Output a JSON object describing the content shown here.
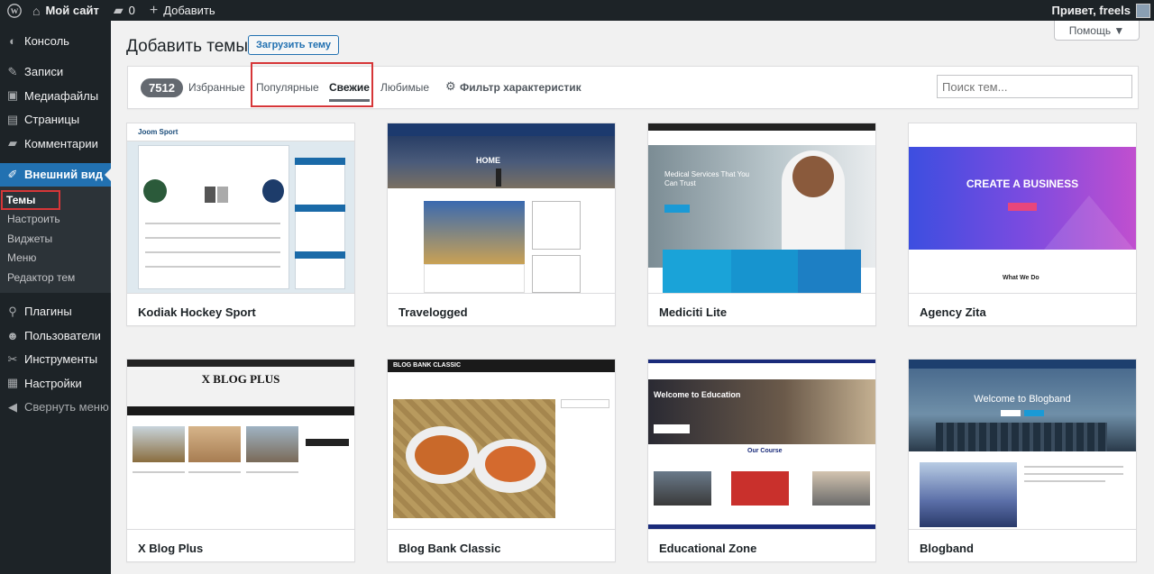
{
  "adminbar": {
    "site_name": "Мой сайт",
    "comments_count": "0",
    "new_label": "Добавить",
    "greeting": "Привет, freels"
  },
  "sidebar": {
    "items": [
      {
        "label": "Консоль",
        "icon": "dashboard-icon"
      },
      {
        "label": "Записи",
        "icon": "pin-icon"
      },
      {
        "label": "Медиафайлы",
        "icon": "media-icon"
      },
      {
        "label": "Страницы",
        "icon": "page-icon"
      },
      {
        "label": "Комментарии",
        "icon": "comment-icon"
      },
      {
        "label": "Внешний вид",
        "icon": "brush-icon"
      },
      {
        "label": "Плагины",
        "icon": "plugin-icon"
      },
      {
        "label": "Пользователи",
        "icon": "users-icon"
      },
      {
        "label": "Инструменты",
        "icon": "wrench-icon"
      },
      {
        "label": "Настройки",
        "icon": "settings-icon"
      },
      {
        "label": "Свернуть меню",
        "icon": "collapse-icon"
      }
    ],
    "submenu": [
      "Темы",
      "Настроить",
      "Виджеты",
      "Меню",
      "Редактор тем"
    ]
  },
  "main": {
    "help_label": "Помощь ▼",
    "title": "Добавить темы",
    "upload_label": "Загрузить тему",
    "count": "7512",
    "tabs": [
      "Избранные",
      "Популярные",
      "Свежие",
      "Любимые",
      "Фильтр характеристик"
    ],
    "search_placeholder": "Поиск тем..."
  },
  "themes": [
    {
      "name": "Kodiak Hockey Sport",
      "shot_text": "Joom Sport"
    },
    {
      "name": "Travelogged",
      "shot_text": "HOME"
    },
    {
      "name": "Mediciti Lite",
      "shot_text": "Medical Services That You Can Trust"
    },
    {
      "name": "Agency Zita",
      "shot_text": "CREATE A BUSINESS"
    },
    {
      "name": "X Blog Plus",
      "shot_text": "X BLOG PLUS"
    },
    {
      "name": "Blog Bank Classic",
      "shot_text": "BLOG BANK CLASSIC"
    },
    {
      "name": "Educational Zone",
      "shot_text": "Welcome to Education"
    },
    {
      "name": "Blogband",
      "shot_text": "Welcome to Blogband"
    }
  ],
  "colors": {
    "admin_dark": "#1d2327",
    "accent": "#2271b1",
    "highlight": "#d63638"
  }
}
